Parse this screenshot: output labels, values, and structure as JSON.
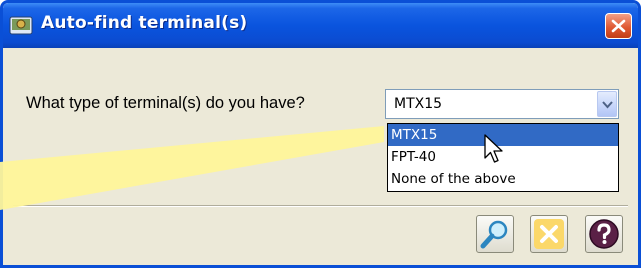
{
  "window": {
    "title": "Auto-find terminal(s)",
    "close_icon": "close-icon"
  },
  "form": {
    "prompt": "What type of terminal(s) do you have?",
    "terminal_select": {
      "value": "MTX15",
      "options": [
        "MTX15",
        "FPT-40",
        "None of the above"
      ],
      "highlighted_option": "MTX15",
      "expanded": true
    }
  },
  "buttons": [
    {
      "name": "search-button",
      "icon": "magnifier-icon"
    },
    {
      "name": "cancel-button",
      "icon": "close-icon"
    },
    {
      "name": "help-button",
      "icon": "question-mark-icon"
    }
  ],
  "colors": {
    "titlebar": "#0a54de",
    "selection": "#316ac5",
    "callout": "#fff59a",
    "dialog_background": "#ece9d8"
  }
}
